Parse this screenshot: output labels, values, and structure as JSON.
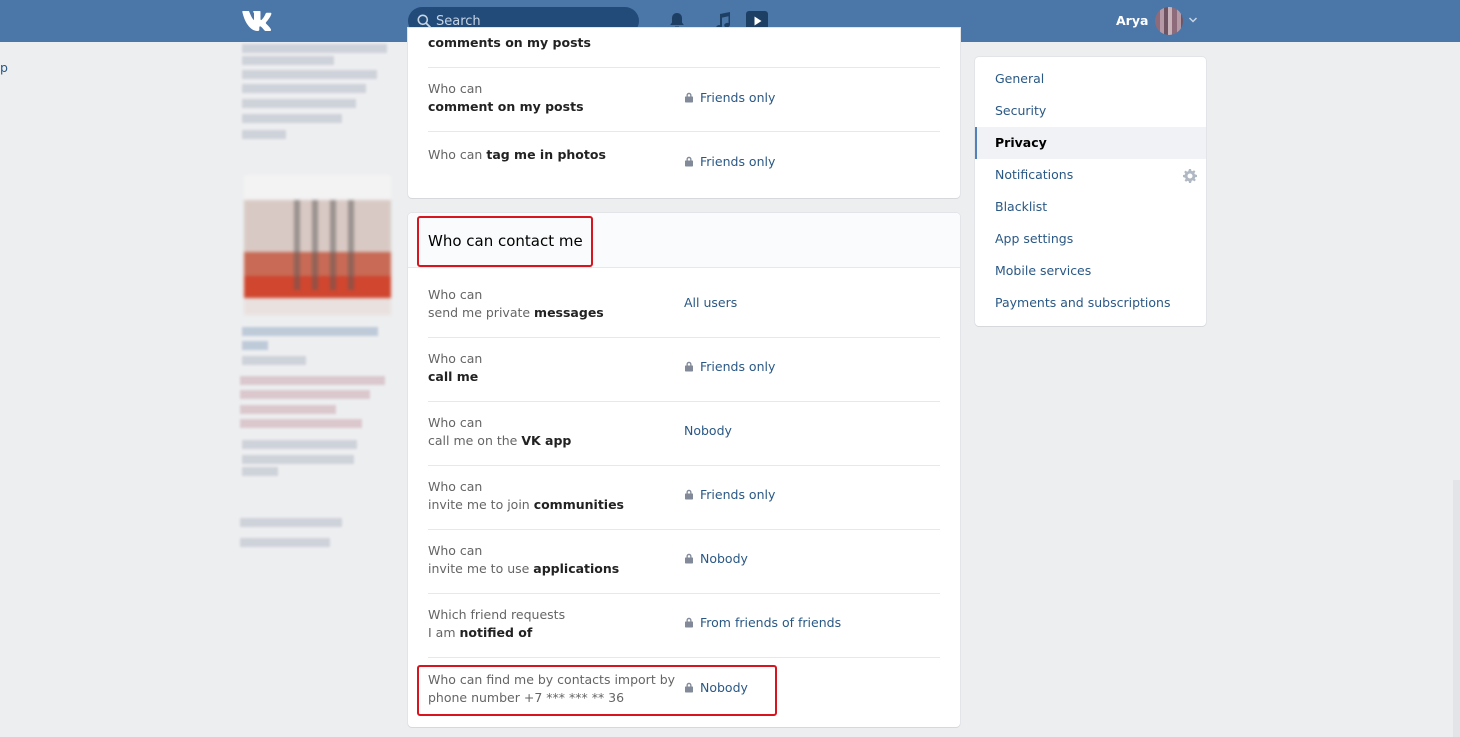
{
  "header": {
    "search_placeholder": "Search",
    "user_name": "Arya",
    "icons": [
      "vk-logo-icon",
      "search-icon",
      "bell-icon",
      "music-icon",
      "video-play-icon",
      "chevron-down-icon"
    ]
  },
  "left_edge_link": "p",
  "top_section": {
    "partial_row": {
      "text_bold": "comments on my posts"
    },
    "rows": [
      {
        "pre": "Who can",
        "rest": "",
        "bold": "comment on my posts",
        "value": "Friends only",
        "locked": true
      },
      {
        "pre": "Who can",
        "rest": "",
        "bold": "tag me in photos",
        "value": "Friends only",
        "locked": true
      }
    ]
  },
  "contact_section": {
    "title": "Who can contact me",
    "rows": [
      {
        "line1": "Who can",
        "line2_plain": "send me private ",
        "line2_bold": "messages",
        "value": "All users",
        "locked": false
      },
      {
        "line1": "Who can",
        "line2_plain": "",
        "line2_bold": "call me",
        "value": "Friends only",
        "locked": true
      },
      {
        "line1": "Who can",
        "line2_plain": "call me on the ",
        "line2_bold": "VK app",
        "value": "Nobody",
        "locked": false
      },
      {
        "line1": "Who can",
        "line2_plain": "invite me to join ",
        "line2_bold": "communities",
        "value": "Friends only",
        "locked": true
      },
      {
        "line1": "Who can",
        "line2_plain": "invite me to use ",
        "line2_bold": "applications",
        "value": "Nobody",
        "locked": true
      },
      {
        "line1": "Which friend requests",
        "line2_plain": "I am ",
        "line2_bold": "notified of",
        "value": "From friends of friends",
        "locked": true
      },
      {
        "line1": "Who can find me by contacts import by",
        "line2_plain": "phone number +7 *** *** ** 36",
        "line2_bold": "",
        "value": "Nobody",
        "locked": true
      }
    ]
  },
  "settings_menu": {
    "items": [
      {
        "label": "General",
        "active": false
      },
      {
        "label": "Security",
        "active": false
      },
      {
        "label": "Privacy",
        "active": true
      },
      {
        "label": "Notifications",
        "active": false,
        "icon": "gear-icon"
      },
      {
        "label": "Blacklist",
        "active": false
      },
      {
        "label": "App settings",
        "active": false
      },
      {
        "label": "Mobile services",
        "active": false
      },
      {
        "label": "Payments and subscriptions",
        "active": false
      }
    ]
  },
  "colors": {
    "header_bg": "#4a76a8",
    "link": "#2a5885",
    "highlight_red": "#d8141f",
    "page_bg": "#edeef0"
  }
}
